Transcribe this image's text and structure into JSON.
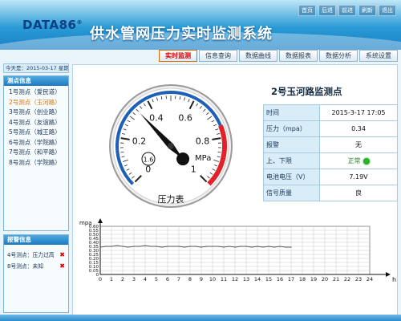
{
  "header": {
    "logo": "DATA86",
    "logo_mark": "®",
    "title": "供水管网压力实时监测系统",
    "links": [
      "首页",
      "后退",
      "前进",
      "刷新",
      "退出"
    ]
  },
  "nav": {
    "tabs": [
      "实时监测",
      "信息查询",
      "数据曲线",
      "数据报表",
      "数据分析",
      "系统设置"
    ],
    "active": "实时监测"
  },
  "sidebar": {
    "date": "今天是：2015-03-17 星期二",
    "stations_title": "测点信息",
    "stations": [
      "1号测点（爱民道）",
      "2号测点（玉河路）",
      "3号测点（创业路）",
      "4号测点（友谊路）",
      "5号测点（城王路）",
      "6号测点（学院路）",
      "7号测点（和平路）",
      "8号测点（学院路）"
    ],
    "selected_index": 1,
    "alarm_title": "报警信息",
    "alarms": [
      {
        "text": "4号测点：压力过高",
        "icon": "alarm-x-icon"
      },
      {
        "text": "8号测点：未知",
        "icon": "alarm-x-icon"
      }
    ]
  },
  "gauge": {
    "value": 0.34,
    "min": 0,
    "max": 1,
    "ticks": [
      "0",
      "0.2",
      "0.4",
      "0.6",
      "0.8",
      "1"
    ],
    "unit": "MPa",
    "class_mark": "1.6",
    "label": "压力表",
    "colors": {
      "blue": "#1e5fb8",
      "red": "#e2222a"
    }
  },
  "station_detail": {
    "title": "2号玉河路监测点",
    "rows": [
      {
        "key": "时间",
        "value": "2015-3-17   17:05"
      },
      {
        "key": "压力（mpa）",
        "value": "0.34"
      },
      {
        "key": "报警",
        "value": "无"
      },
      {
        "key": "上、下限",
        "value": "正常",
        "icon": "status-green-light-icon"
      },
      {
        "key": "电池电压（V）",
        "value": "7.19V"
      },
      {
        "key": "信号质量",
        "value": "良"
      }
    ]
  },
  "chart_data": {
    "type": "line",
    "ylabel": "mpa",
    "xlabel": "h",
    "ylim": [
      0,
      0.6
    ],
    "xlim": [
      0,
      24
    ],
    "y_ticks": [
      "0",
      "0.05",
      "0.10",
      "0.15",
      "0.20",
      "0.25",
      "0.30",
      "0.35",
      "0.40",
      "0.45",
      "0.50",
      "0.55",
      "0.60"
    ],
    "x_ticks": [
      "0",
      "1",
      "2",
      "3",
      "4",
      "5",
      "6",
      "7",
      "8",
      "9",
      "10",
      "11",
      "12",
      "13",
      "14",
      "15",
      "16",
      "17",
      "18",
      "19",
      "20",
      "21",
      "22",
      "23",
      "24"
    ],
    "grid": true,
    "series": [
      {
        "values_x": [
          0,
          0.5,
          1,
          1.5,
          2,
          2.5,
          3,
          3.5,
          4,
          4.5,
          5,
          5.5,
          6,
          6.5,
          7,
          7.5,
          8,
          8.5,
          9,
          9.5,
          10,
          10.5,
          11,
          11.5,
          12,
          12.5,
          13,
          13.5,
          14,
          14.5,
          15,
          15.5,
          16,
          16.5,
          17
        ],
        "values_y": [
          0.34,
          0.35,
          0.35,
          0.36,
          0.35,
          0.34,
          0.35,
          0.35,
          0.36,
          0.35,
          0.35,
          0.34,
          0.35,
          0.35,
          0.35,
          0.34,
          0.35,
          0.35,
          0.34,
          0.35,
          0.35,
          0.35,
          0.34,
          0.35,
          0.34,
          0.35,
          0.35,
          0.34,
          0.35,
          0.34,
          0.35,
          0.34,
          0.35,
          0.34,
          0.34
        ],
        "color": "#555555"
      }
    ]
  }
}
